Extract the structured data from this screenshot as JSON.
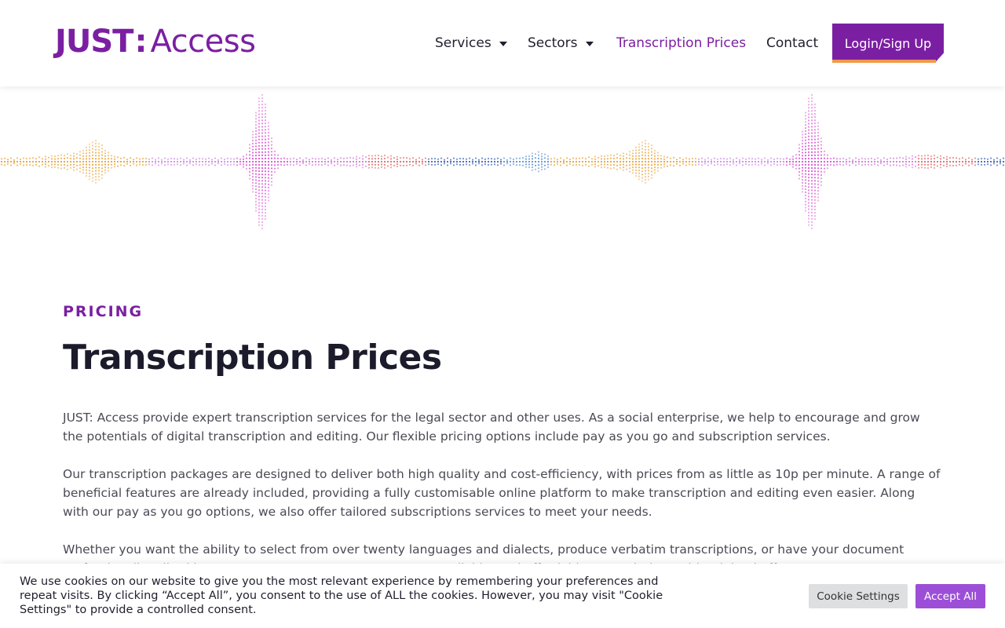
{
  "logo": {
    "part1": "JUST",
    "part2": ":",
    "part3": "Access"
  },
  "nav": {
    "items": [
      {
        "label": "Services"
      },
      {
        "label": "Sectors"
      },
      {
        "label": "Transcription Prices"
      },
      {
        "label": "Contact"
      }
    ],
    "login_label": "Login/Sign Up"
  },
  "colors": {
    "brand": "#7b1fa2",
    "accent_orange": "#f2994a",
    "accept_button": "#9c4fd6"
  },
  "main": {
    "eyebrow": "PRICING",
    "title": "Transcription Prices",
    "paragraphs": [
      "JUST: Access provide expert transcription services for the legal sector and other uses. As a social enterprise, we help to encourage and grow the potentials of digital transcription and editing. Our flexible pricing options include pay as you go and subscription services.",
      "Our transcription packages are designed to deliver both high quality and cost-efficiency, with prices from as little as 10p per minute. A range of beneficial features are already included, providing a fully customisable online platform to make transcription and editing even easier. Along with our pay as you go options, we also offer tailored subscriptions services to meet your needs.",
      "Whether you want the ability to select from over twenty languages and dialects, produce verbatim transcriptions, or have your document professionally edited by our experts, you can create accurate, reliable, and affordable transcriptions with minimal effort."
    ]
  },
  "cookie": {
    "text": "We use cookies on our website to give you the most relevant experience by remembering your preferences and repeat visits. By clicking “Accept All”, you consent to the use of ALL the cookies. However, you may visit \"Cookie Settings\" to provide a controlled consent.",
    "settings_label": "Cookie Settings",
    "accept_label": "Accept All"
  }
}
